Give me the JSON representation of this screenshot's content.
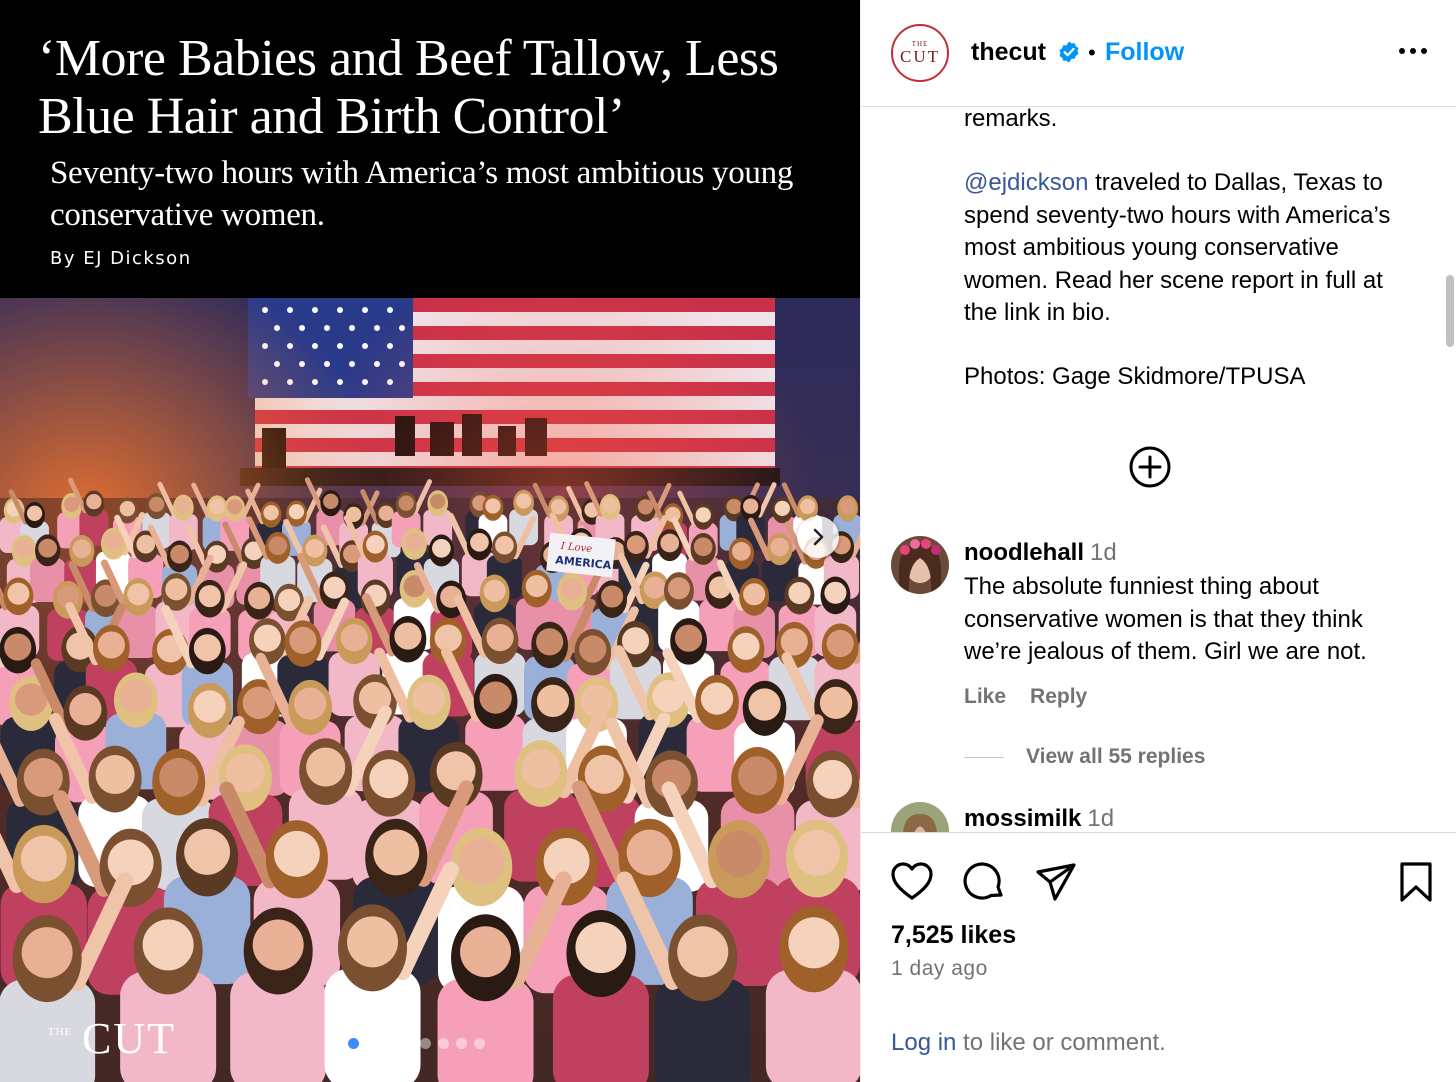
{
  "media": {
    "headline": "‘More Babies and Beef Tallow, Less Blue Hair and Birth Control’",
    "subheadline": "Seventy-two hours with America’s most ambitious young conservative women.",
    "byline": "By EJ Dickson",
    "sign_text": "I Love AMERICA",
    "watermark_small": "THE",
    "watermark_large": "CUT",
    "carousel": {
      "count": 8,
      "active_index": 0
    },
    "next_icon": "chevron-right-icon"
  },
  "header": {
    "avatar_small": "THE",
    "avatar_large": "CUT",
    "username": "thecut",
    "verified_icon": "verified-badge-icon",
    "separator": "•",
    "follow_label": "Follow",
    "more_icon": "more-options-icon"
  },
  "caption": {
    "remarks": "remarks.",
    "mention": "@ejdickson",
    "body": " traveled to Dallas, Texas to spend seventy-two hours with America’s most ambitious young conservative women. Read her scene report in full at the link in bio.",
    "credit": "Photos: Gage Skidmore/TPUSA"
  },
  "comments": [
    {
      "username": "noodlehall",
      "time": "1d",
      "text": "The absolute funniest thing about conservative women is that they think we’re jealous of them. Girl we are not.",
      "like_label": "Like",
      "reply_label": "Reply",
      "view_replies": "View all 55 replies"
    },
    {
      "username": "mossimilk",
      "time": "1d"
    }
  ],
  "actions": {
    "icons": [
      "heart-icon",
      "comment-icon",
      "share-icon",
      "bookmark-icon"
    ],
    "likes": "7,525 likes",
    "posted": "1 day ago",
    "login_link": "Log in",
    "login_rest": " to like or comment."
  },
  "colors": {
    "accent_blue": "#0095f6",
    "link_blue": "#385898",
    "muted_gray": "#737373",
    "cut_red": "#c12f36"
  }
}
